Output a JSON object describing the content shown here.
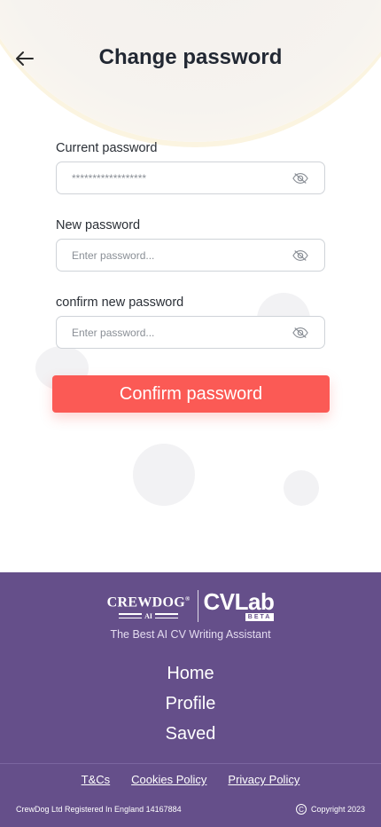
{
  "header": {
    "back_icon": "arrow-left-icon",
    "title": "Change password"
  },
  "form": {
    "current": {
      "label": "Current password",
      "value": "******************",
      "placeholder": "",
      "icon": "eye-off-icon"
    },
    "new": {
      "label": "New password",
      "value": "",
      "placeholder": "Enter password...",
      "icon": "eye-off-icon"
    },
    "confirm": {
      "label": "confirm new password",
      "value": "",
      "placeholder": "Enter password...",
      "icon": "eye-off-icon"
    },
    "submit_label": "Confirm password"
  },
  "footer": {
    "logo_crewdog": "CREWDOG",
    "logo_registered": "®",
    "logo_ai": "AI",
    "logo_cvlab": "CVLab",
    "logo_beta": "BETA",
    "tagline": "The Best AI CV Writing Assistant",
    "nav": [
      "Home",
      "Profile",
      "Saved"
    ],
    "legal": [
      "T&Cs",
      "Cookies Policy",
      "Privacy Policy"
    ],
    "registered_text": "CrewDog Ltd Registered In England 14167884",
    "copyright_symbol": "C",
    "copyright_text": "Copyright 2023"
  },
  "colors": {
    "accent": "#fb5a55",
    "footer_bg": "#654f8a",
    "title": "#222833"
  }
}
